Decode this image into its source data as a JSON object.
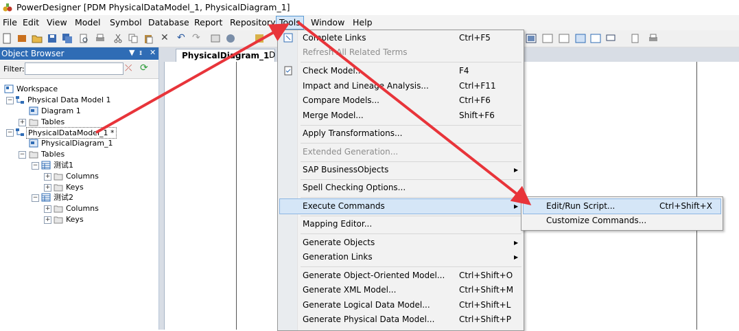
{
  "window": {
    "title": "PowerDesigner [PDM PhysicalDataModel_1, PhysicalDiagram_1]"
  },
  "menubar": [
    "File",
    "Edit",
    "View",
    "Model",
    "Symbol",
    "Database",
    "Report",
    "Repository",
    "Tools",
    "Window",
    "Help"
  ],
  "object_browser": {
    "title": "Object Browser",
    "filter_label": "Filter:",
    "filter_value": "",
    "tree": [
      "Workspace",
      "Physical Data Model 1",
      "Diagram 1",
      "Tables",
      "PhysicalDataModel_1 *",
      "PhysicalDiagram_1",
      "Tables",
      "测试1",
      "Columns",
      "Keys",
      "测试2",
      "Columns",
      "Keys"
    ]
  },
  "diagram": {
    "tabs": [
      "PhysicalDiagram_1",
      "D"
    ]
  },
  "tools_menu": {
    "items": [
      {
        "label": "Complete Links",
        "shortcut": "Ctrl+F5"
      },
      {
        "label": "Refresh All Related Terms",
        "shortcut": ""
      },
      {
        "label": "Check Model...",
        "shortcut": "F4"
      },
      {
        "label": "Impact and Lineage Analysis...",
        "shortcut": "Ctrl+F11"
      },
      {
        "label": "Compare Models...",
        "shortcut": "Ctrl+F6"
      },
      {
        "label": "Merge Model...",
        "shortcut": "Shift+F6"
      },
      {
        "label": "Apply Transformations...",
        "shortcut": ""
      },
      {
        "label": "Extended Generation...",
        "shortcut": ""
      },
      {
        "label": "SAP BusinessObjects",
        "shortcut": ""
      },
      {
        "label": "Spell Checking Options...",
        "shortcut": ""
      },
      {
        "label": "Execute Commands",
        "shortcut": ""
      },
      {
        "label": "Mapping Editor...",
        "shortcut": ""
      },
      {
        "label": "Generate Objects",
        "shortcut": ""
      },
      {
        "label": "Generation Links",
        "shortcut": ""
      },
      {
        "label": "Generate Object-Oriented Model...",
        "shortcut": "Ctrl+Shift+O"
      },
      {
        "label": "Generate XML Model...",
        "shortcut": "Ctrl+Shift+M"
      },
      {
        "label": "Generate Logical Data Model...",
        "shortcut": "Ctrl+Shift+L"
      },
      {
        "label": "Generate Physical Data Model...",
        "shortcut": "Ctrl+Shift+P"
      }
    ]
  },
  "execute_submenu": {
    "items": [
      {
        "label": "Edit/Run Script...",
        "shortcut": "Ctrl+Shift+X"
      },
      {
        "label": "Customize Commands...",
        "shortcut": ""
      }
    ]
  },
  "colors": {
    "accent": "#2f6cb5",
    "highlight": "#d5e6f7",
    "arrow": "#e8343a"
  },
  "icons": [
    "powerdesigner-logo-icon",
    "workspace-icon",
    "model-icon",
    "diagram-icon",
    "folder-icon",
    "table-icon",
    "check-model-icon",
    "arrow-right-icon"
  ]
}
